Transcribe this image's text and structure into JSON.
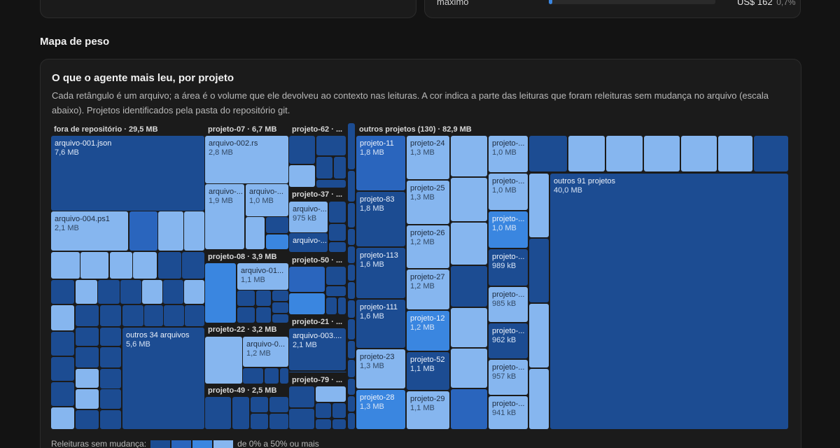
{
  "top_right": {
    "label": "máximo",
    "value": "US$ 162",
    "pct": "0,7%",
    "fill": 0.02
  },
  "section_title": "Mapa de peso",
  "card": {
    "title": "O que o agente mais leu, por projeto",
    "description": "Cada retângulo é um arquivo; a área é o volume que ele devolveu ao contexto nas leituras. A cor indica a parte das leituras que foram releituras sem mudança no arquivo (escala abaixo). Projetos identificados pela pasta do repositório git."
  },
  "legend": {
    "label": "Releituras sem mudança:",
    "range": "de 0% a 50% ou mais",
    "colors": [
      "#1c4c92",
      "#2a65bd",
      "#3a86e0",
      "#86b6ef"
    ]
  },
  "colors": {
    "c0": "#1c4c92",
    "c1": "#2a65bd",
    "c2": "#3a86e0",
    "c3": "#86b6ef"
  },
  "treemap": {
    "groups": [
      {
        "label": "fora de repositório · 29,5 MB"
      },
      {
        "label": "projeto-07 · 6,7 MB"
      },
      {
        "label": "projeto-62 · ..."
      },
      {
        "label": "outros projetos (130) · 82,9 MB"
      },
      {
        "label": "projeto-37 · ..."
      },
      {
        "label": "projeto-50 · ..."
      },
      {
        "label": "projeto-08 · 3,9 MB"
      },
      {
        "label": "projeto-21 · ..."
      },
      {
        "label": "projeto-22 · 3,2 MB"
      },
      {
        "label": "projeto-79 · ..."
      },
      {
        "label": "projeto-49 · 2,5 MB"
      }
    ],
    "tiles": [
      {
        "name": "arquivo-001.json",
        "size": "7,6 MB",
        "color": "c0"
      },
      {
        "name": "arquivo-004.ps1",
        "size": "2,1 MB",
        "color": "c3"
      },
      {
        "name": "outros 34 arquivos",
        "size": "5,6 MB",
        "color": "c0"
      },
      {
        "name": "arquivo-002.rs",
        "size": "2,8 MB",
        "color": "c3"
      },
      {
        "name": "arquivo-...",
        "size": "1,9 MB",
        "color": "c3"
      },
      {
        "name": "arquivo-...",
        "size": "1,0 MB",
        "color": "c3"
      },
      {
        "name": "arquivo-...",
        "size": "975 kB",
        "color": "c3"
      },
      {
        "name": "arquivo-...",
        "size": "",
        "color": "c0"
      },
      {
        "name": "arquivo-01...",
        "size": "1,1 MB",
        "color": "c3"
      },
      {
        "name": "arquivo-003....",
        "size": "2,1 MB",
        "color": "c0"
      },
      {
        "name": "arquivo-0...",
        "size": "1,2 MB",
        "color": "c3"
      },
      {
        "name": "projeto-11",
        "size": "1,8 MB",
        "color": "c1"
      },
      {
        "name": "projeto-83",
        "size": "1,8 MB",
        "color": "c0"
      },
      {
        "name": "projeto-113",
        "size": "1,6 MB",
        "color": "c0"
      },
      {
        "name": "projeto-111",
        "size": "1,6 MB",
        "color": "c0"
      },
      {
        "name": "projeto-23",
        "size": "1,3 MB",
        "color": "c3"
      },
      {
        "name": "projeto-28",
        "size": "1,3 MB",
        "color": "c2"
      },
      {
        "name": "projeto-24",
        "size": "1,3 MB",
        "color": "c3"
      },
      {
        "name": "projeto-25",
        "size": "1,3 MB",
        "color": "c3"
      },
      {
        "name": "projeto-26",
        "size": "1,2 MB",
        "color": "c3"
      },
      {
        "name": "projeto-27",
        "size": "1,2 MB",
        "color": "c3"
      },
      {
        "name": "projeto-12",
        "size": "1,2 MB",
        "color": "c2"
      },
      {
        "name": "projeto-52",
        "size": "1,1 MB",
        "color": "c0"
      },
      {
        "name": "projeto-29",
        "size": "1,1 MB",
        "color": "c3"
      },
      {
        "name": "projeto-...",
        "size": "1,0 MB",
        "color": "c3"
      },
      {
        "name": "projeto-...",
        "size": "1,0 MB",
        "color": "c3"
      },
      {
        "name": "projeto-...",
        "size": "1,0 MB",
        "color": "c2"
      },
      {
        "name": "projeto-...",
        "size": "989 kB",
        "color": "c0"
      },
      {
        "name": "projeto-...",
        "size": "985 kB",
        "color": "c3"
      },
      {
        "name": "projeto-...",
        "size": "962 kB",
        "color": "c0"
      },
      {
        "name": "projeto-...",
        "size": "957 kB",
        "color": "c3"
      },
      {
        "name": "projeto-...",
        "size": "941 kB",
        "color": "c3"
      },
      {
        "name": "outros 91 projetos",
        "size": "40,0 MB",
        "color": "c0"
      }
    ]
  }
}
